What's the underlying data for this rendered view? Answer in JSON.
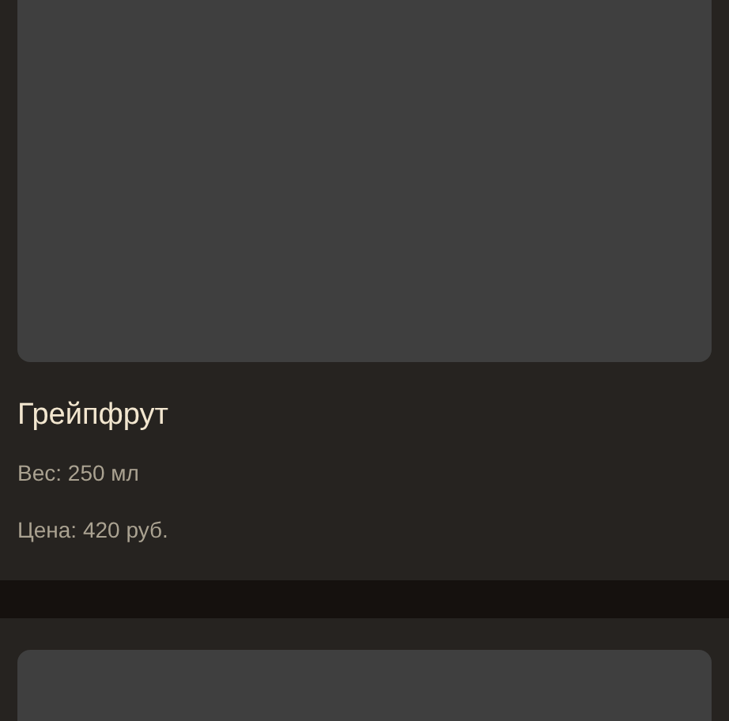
{
  "cards": [
    {
      "kind": "full",
      "name": "Грейпфрут",
      "weight": "Вес: 250 мл",
      "price": "Цена: 420 руб."
    },
    {
      "kind": "cut"
    }
  ]
}
